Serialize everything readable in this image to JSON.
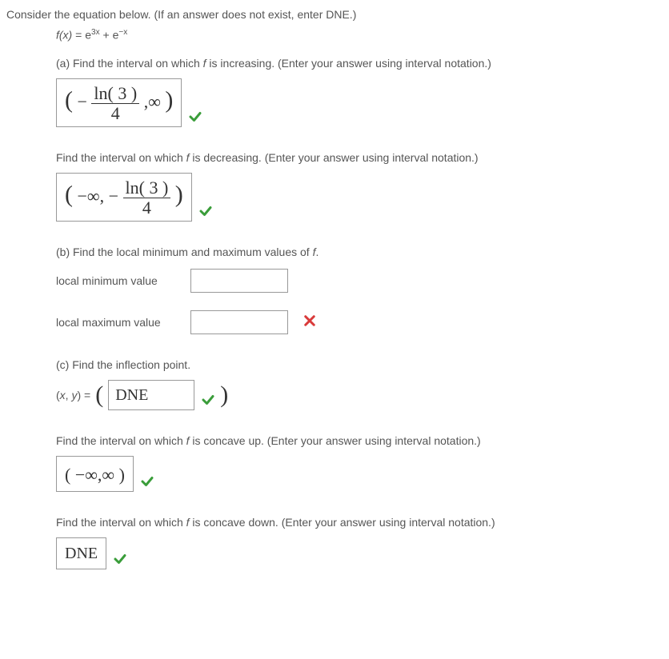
{
  "intro": "Consider the equation below. (If an answer does not exist, enter DNE.)",
  "fx_lhs": "f(x)",
  "fx_eq": " = ",
  "fx_e": "e",
  "fx_exp1": "3x",
  "fx_plus": " + ",
  "fx_exp2": "−x",
  "a_prompt": "(a) Find the interval on which f is increasing. (Enter your answer using interval notation.)",
  "a_answer_preneg": "−",
  "a_answer_frac_num": "ln( 3 )",
  "a_answer_frac_den": "4",
  "a_answer_post": ",∞",
  "dec_prompt": "Find the interval on which f is decreasing. (Enter your answer using interval notation.)",
  "dec_answer_pre": "−∞, −",
  "dec_answer_frac_num": "ln( 3 )",
  "dec_answer_frac_den": "4",
  "b_prompt": "(b) Find the local minimum and maximum values of f.",
  "b_min_label": "local minimum value",
  "b_max_label": "local maximum value",
  "c_prompt": "(c) Find the inflection point.",
  "c_lhs": "(x, y) = ",
  "c_value": "DNE",
  "cu_prompt": "Find the interval on which f is concave up. (Enter your answer using interval notation.)",
  "cu_answer": "( −∞,∞ )",
  "cd_prompt": "Find the interval on which f is concave down. (Enter your answer using interval notation.)",
  "cd_answer": "DNE"
}
